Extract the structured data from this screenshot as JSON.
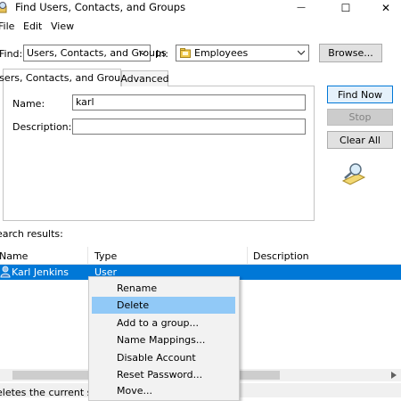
{
  "window": {
    "title": "Find Users, Contacts, and Groups",
    "buttons": {
      "minimize": "—",
      "maximize": "☐",
      "close": "✕"
    }
  },
  "menu": [
    "File",
    "Edit",
    "View"
  ],
  "find_row": {
    "find_label": "Find:",
    "find_value": "Users, Contacts, and Groups",
    "in_label": "In:",
    "in_value": "Employees",
    "browse_label": "Browse..."
  },
  "tabs": [
    "Users, Contacts, and Groups",
    "Advanced"
  ],
  "form": {
    "name_label": "Name:",
    "name_value": "karl",
    "description_label": "Description:",
    "description_value": ""
  },
  "actions": {
    "find_now": "Find Now",
    "stop": "Stop",
    "clear_all": "Clear All"
  },
  "results": {
    "label": "earch results:",
    "columns": [
      "Name",
      "Type",
      "Description"
    ],
    "rows": [
      {
        "name": "Karl Jenkins",
        "type": "User",
        "description": ""
      }
    ]
  },
  "context_menu": [
    "Rename",
    "Delete",
    "Add to a group...",
    "Name Mappings...",
    "Disable Account",
    "Reset Password...",
    "Move..."
  ],
  "status": "eletes the current sele",
  "colors": {
    "selection": "#0078d7",
    "menu_highlight": "#91c9f7",
    "accent_border": "#0078d7"
  }
}
